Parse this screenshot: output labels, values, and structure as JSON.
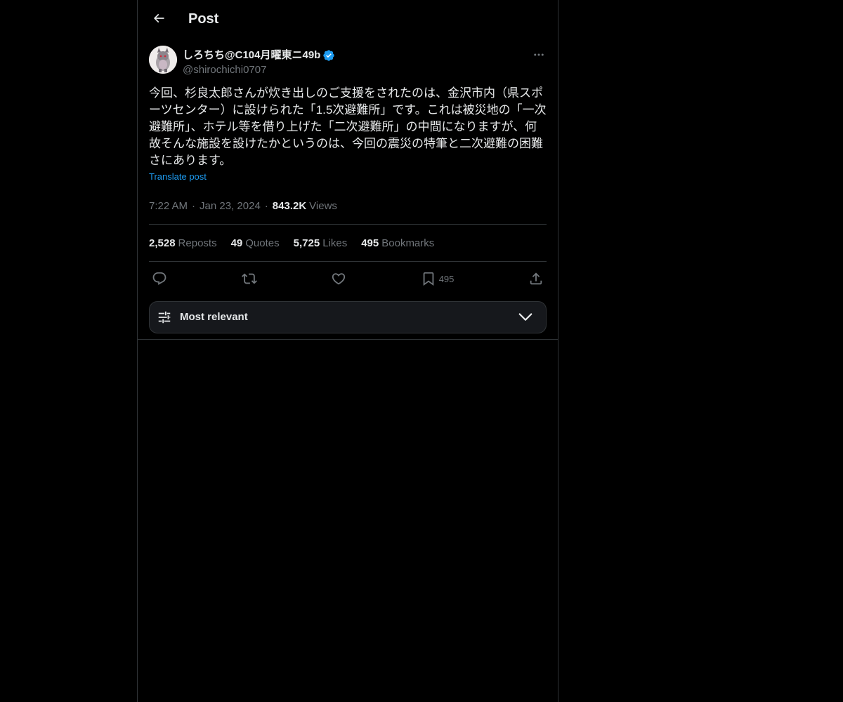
{
  "header": {
    "title": "Post",
    "back_icon": "arrow-left-icon"
  },
  "post": {
    "author": {
      "display_name": "しろちち@C104月曜東ニ49b",
      "handle": "@shirochichi0707",
      "verified": true,
      "verified_color": "#1d9bf0"
    },
    "text": "今回、杉良太郎さんが炊き出しのご支援をされたのは、金沢市内（県スポーツセンター）に設けられた「1.5次避難所」です。これは被災地の「一次避難所」、ホテル等を借り上げた「二次避難所」の中間になりますが、何故そんな施設を設けたかというのは、今回の震災の特筆と二次避難の困難さにあります。",
    "translate_label": "Translate post",
    "time": "7:22 AM",
    "date": "Jan 23, 2024",
    "views_count": "843.2K",
    "views_label": "Views"
  },
  "stats": [
    {
      "count": "2,528",
      "label": "Reposts"
    },
    {
      "count": "49",
      "label": "Quotes"
    },
    {
      "count": "5,725",
      "label": "Likes"
    },
    {
      "count": "495",
      "label": "Bookmarks"
    }
  ],
  "actions": {
    "reply_icon": "reply-icon",
    "repost_icon": "repost-icon",
    "like_icon": "heart-icon",
    "bookmark_icon": "bookmark-icon",
    "bookmark_count": "495",
    "share_icon": "share-icon"
  },
  "sort": {
    "label": "Most relevant",
    "icon": "sliders-icon",
    "chevron": "chevron-down-icon"
  },
  "colors": {
    "background": "#000000",
    "text_primary": "#e7e9ea",
    "text_secondary": "#71767b",
    "accent": "#1d9bf0",
    "border": "#2f3336"
  }
}
